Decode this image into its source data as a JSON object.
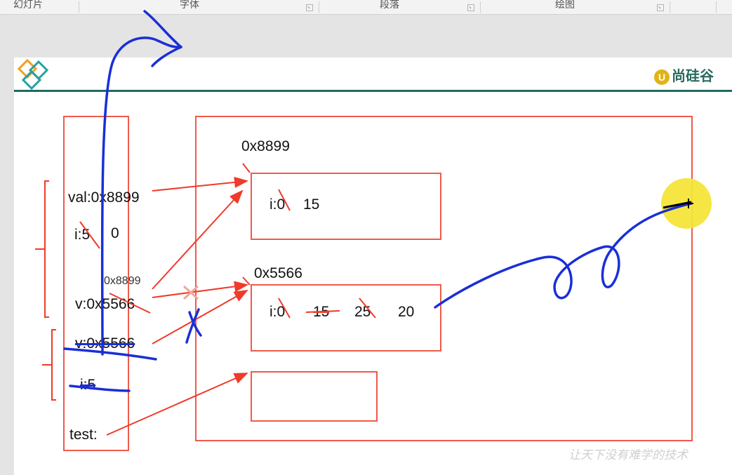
{
  "ribbon": {
    "groups": [
      "幻灯片",
      "字体",
      "段落",
      "绘图"
    ]
  },
  "slide": {
    "brand": "尚硅谷",
    "brand_mark": "U",
    "footer": "让天下没有难学的技术",
    "stack": {
      "val": "val:0x8899",
      "i_name": "i:5",
      "i_new": "0",
      "v_note": "0x8899",
      "v1": "v:0x5566",
      "v2": "v:0x5566",
      "i2": "i:5",
      "test": "test:"
    },
    "heap": {
      "obj1_addr": "0x8899",
      "obj1_old": "i:0",
      "obj1_new": "15",
      "obj2_addr": "0x5566",
      "obj2_old": "i:0",
      "obj2_v1": "15",
      "obj2_v2": "25",
      "obj2_v3": "20"
    }
  },
  "colors": {
    "arrow": "#f03a2a",
    "ink": "#1a2fd6",
    "brand": "#2a6a5e"
  }
}
